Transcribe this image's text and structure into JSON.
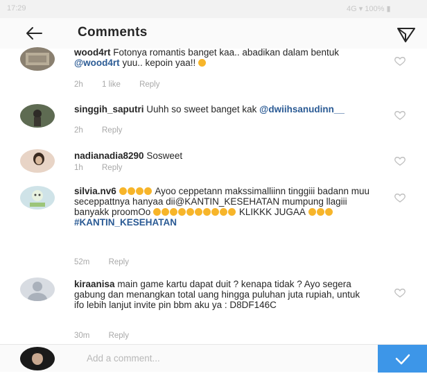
{
  "status_bar": {
    "left": "17:29",
    "right": "4G ▾ 100% ▮"
  },
  "header": {
    "title": "Comments"
  },
  "comments": [
    {
      "username": "wood4rt",
      "text_before": "Fotonya romantis banget kaa.. abadikan dalam bentuk",
      "mention": "@wood4rt",
      "text_after": "yuu.. kepoin yaa!!",
      "time": "2h",
      "likes": "1 like",
      "reply": "Reply"
    },
    {
      "username": "singgih_saputri",
      "text": "Uuhh so sweet banget kak",
      "mention": "@dwiihsanudinn__",
      "time": "2h",
      "reply": "Reply"
    },
    {
      "username": "nadianadia8290",
      "text": "Sosweet",
      "time": "1h",
      "reply": "Reply"
    },
    {
      "username": "silvia.nv6",
      "text_1": "Ayoo ceppetann makssimalliinn tinggiii badann muu seceppattnya hanyaa dii@KANTIN_KESEHATAN  mumpung llagiii banyakk proomOo",
      "text_2": "KLIKKK JUGAA",
      "hashtag": "#KANTIN_KESEHATAN",
      "time": "52m",
      "reply": "Reply"
    },
    {
      "username": "kiraanisa",
      "text": "main game kartu dapat duit ? kenapa tidak ? Ayo segera gabung dan menangkan total uang hingga puluhan juta rupiah, untuk ifo lebih lanjut invite pin bbm aku ya : D8DF146C",
      "time": "30m",
      "reply": "Reply"
    }
  ],
  "composer": {
    "placeholder": "Add a comment..."
  },
  "colors": {
    "accent": "#3d96e8",
    "mention": "#2a5a94",
    "meta": "#a8a8a8"
  },
  "icons": [
    "back-arrow-icon",
    "send-icon",
    "heart-icon",
    "checkmark-icon"
  ]
}
